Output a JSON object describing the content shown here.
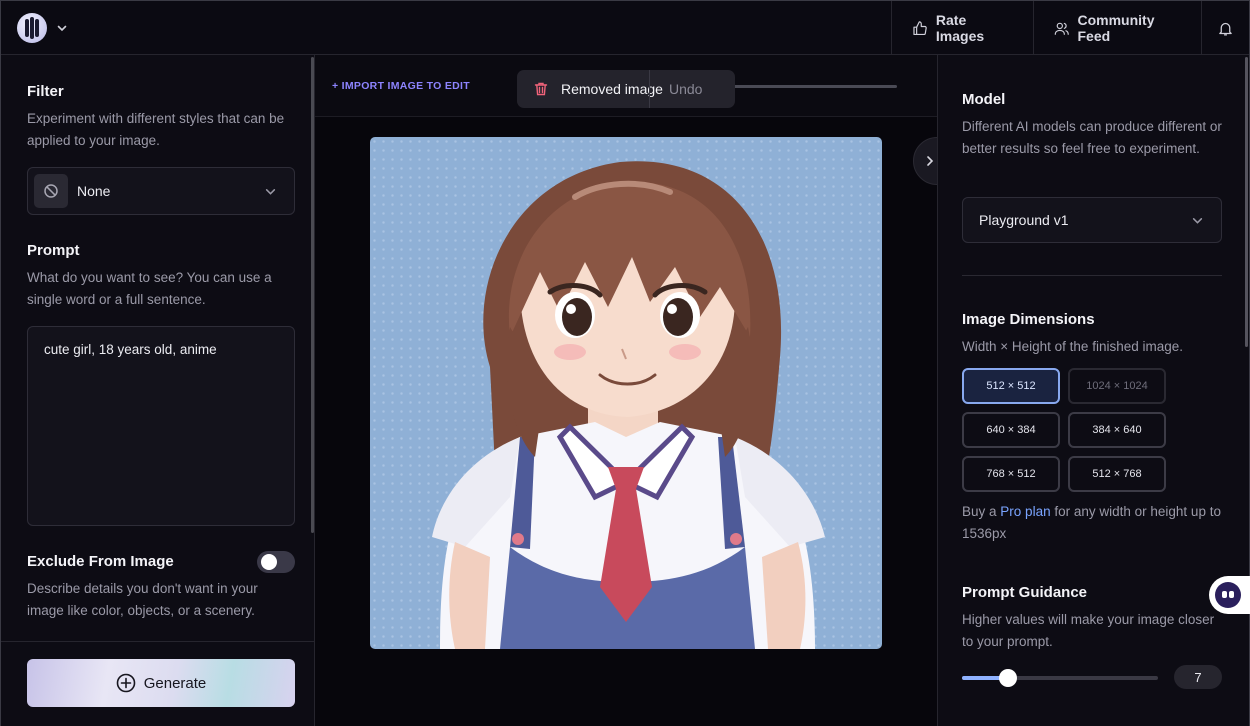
{
  "topbar": {
    "rate_label": "Rate Images",
    "feed_label": "Community Feed"
  },
  "filter": {
    "title": "Filter",
    "description": "Experiment with different styles that can be applied to your image.",
    "selected": "None"
  },
  "prompt": {
    "title": "Prompt",
    "description": "What do you want to see? You can use a single word or a full sentence.",
    "value": "cute girl, 18 years old, anime"
  },
  "exclude": {
    "title": "Exclude From Image",
    "description": "Describe details you don't want in your image like color, objects, or a scenery.",
    "enabled": false
  },
  "generate": {
    "label": "Generate"
  },
  "canvas": {
    "import_label": "+ IMPORT IMAGE TO EDIT",
    "toast_message": "Removed image",
    "undo_label": "Undo"
  },
  "model": {
    "title": "Model",
    "description": "Different AI models can produce different or better results so feel free to experiment.",
    "selected": "Playground v1"
  },
  "dimensions": {
    "title": "Image Dimensions",
    "description": "Width × Height of the finished image.",
    "options": [
      "512 × 512",
      "1024 × 1024",
      "640 × 384",
      "384 × 640",
      "768 × 512",
      "512 × 768"
    ],
    "selected": "512 × 512",
    "pro_prefix": "Buy a",
    "pro_link": "Pro plan",
    "pro_suffix": "for any width or height up to 1536px"
  },
  "guidance": {
    "title": "Prompt Guidance",
    "description": "Higher values will make your image closer to your prompt.",
    "value": "7",
    "min": 0,
    "max": 30,
    "level": 7
  },
  "colors": {
    "accent_link": "#8d84ff",
    "selected_dim": "#88a8ee",
    "pro_link": "#7aa4ff"
  }
}
